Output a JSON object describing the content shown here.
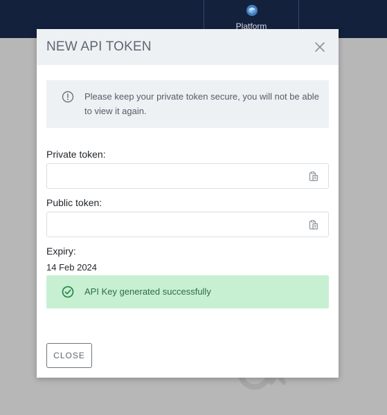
{
  "topbar": {
    "tab": {
      "label": "Platform",
      "icon": "platform-icon"
    }
  },
  "modal": {
    "title": "NEW API TOKEN",
    "close_icon": "close-icon",
    "info": {
      "icon": "info-circle-icon",
      "text": "Please keep your private token secure, you will not be able to view it again."
    },
    "private_token": {
      "label": "Private token:",
      "value": "",
      "copy_icon": "clipboard-icon"
    },
    "public_token": {
      "label": "Public token:",
      "value": "",
      "copy_icon": "clipboard-icon"
    },
    "expiry": {
      "label": "Expiry:",
      "value": "14 Feb 2024"
    },
    "success": {
      "icon": "check-circle-icon",
      "text": "API Key generated successfully"
    },
    "close_button": "CLOSE"
  },
  "colors": {
    "topbar": "#14213d",
    "overlay": "#b7b7b7",
    "header_bg": "#edf1f4",
    "success_bg": "#c7f0d3",
    "success_text": "#2e6b42"
  }
}
